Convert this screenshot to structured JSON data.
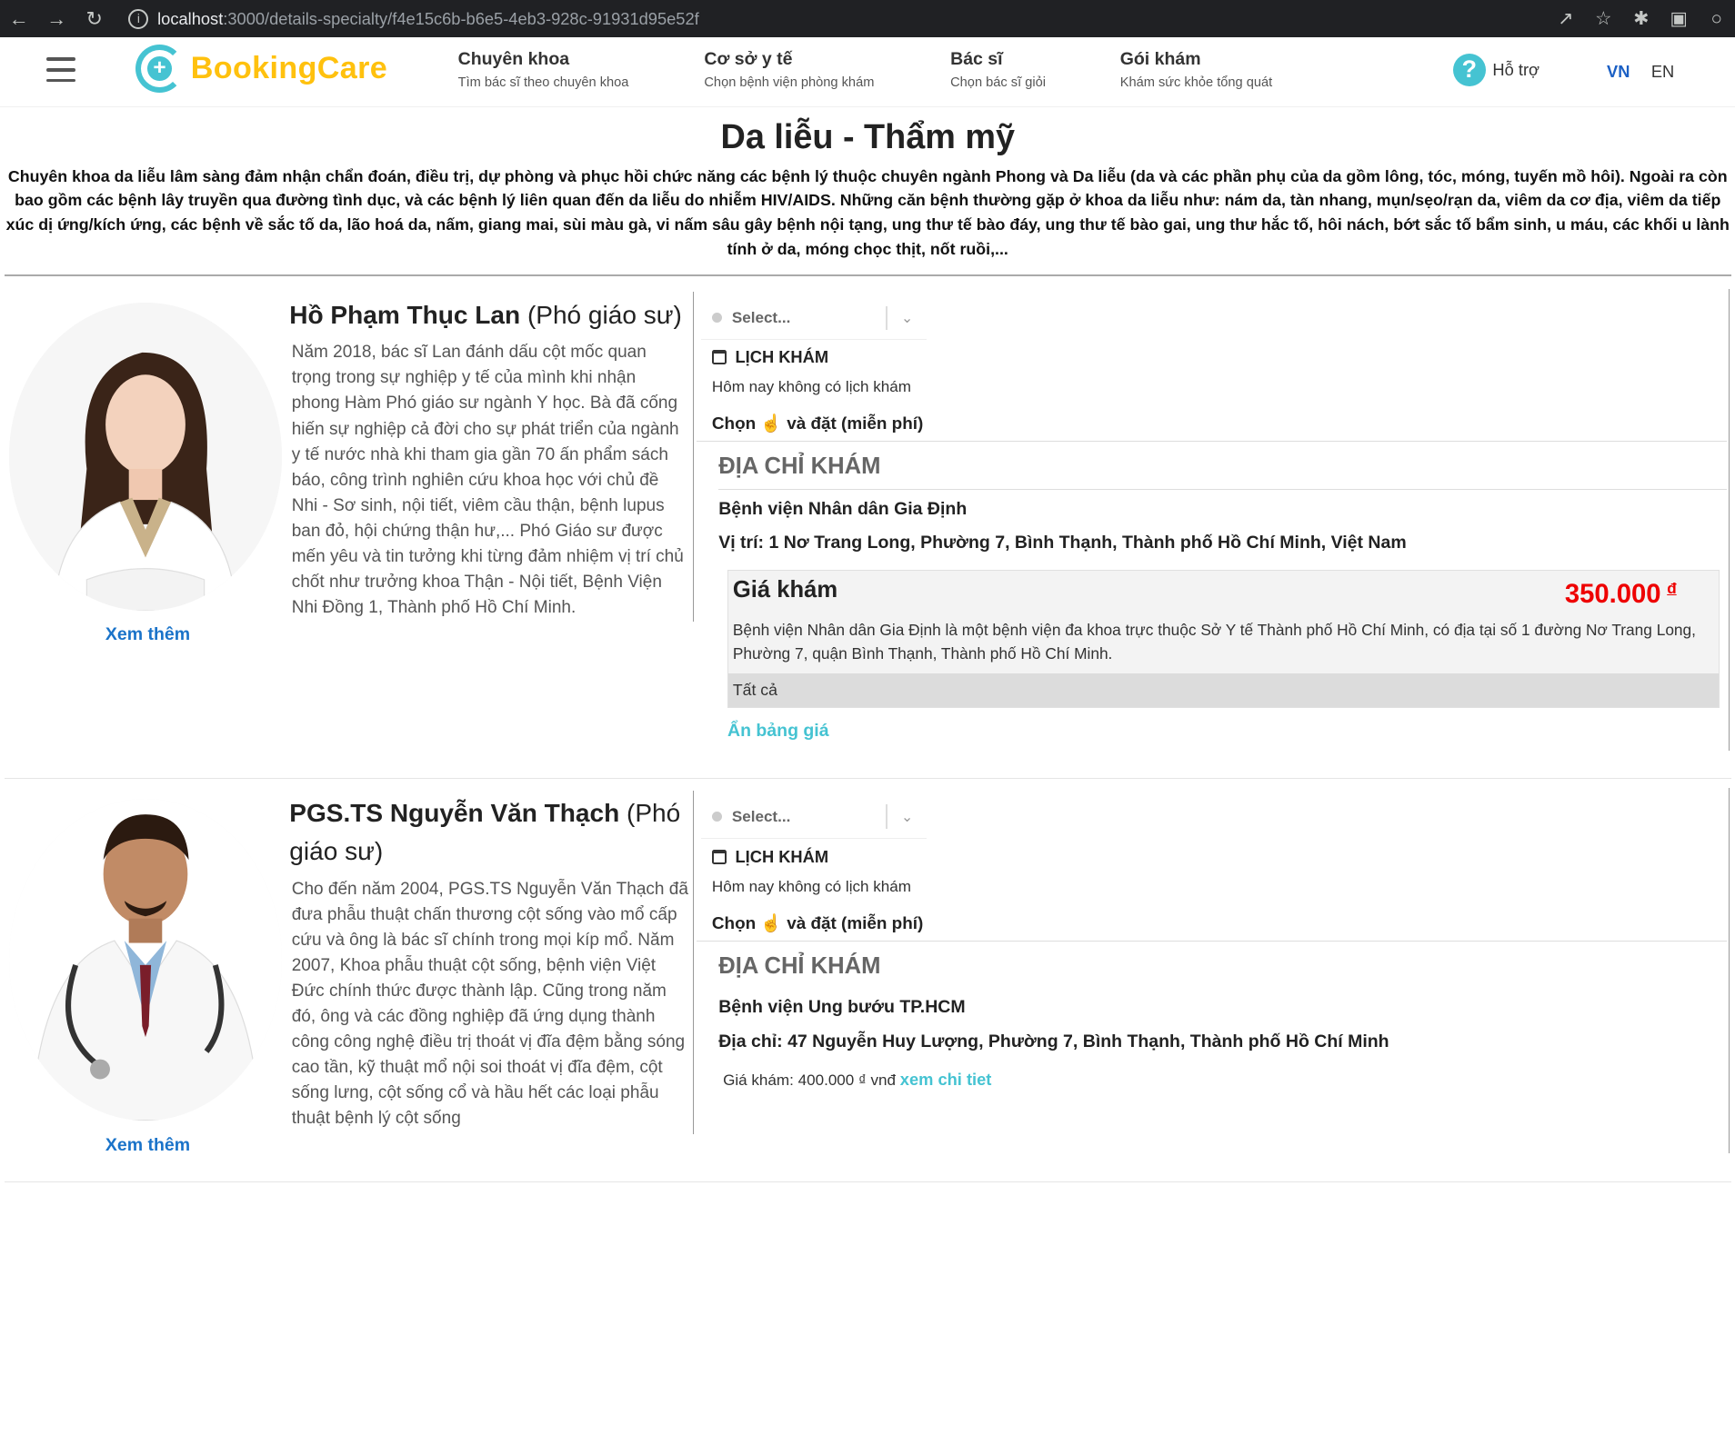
{
  "browser": {
    "url_host": "localhost",
    "url_rest": ":3000/details-specialty/f4e15c6b-b6e5-4eb3-928c-91931d95e52f"
  },
  "header": {
    "logo_text": "BookingCare",
    "menu": [
      {
        "title": "Chuyên khoa",
        "sub": "Tìm bác sĩ theo chuyên khoa"
      },
      {
        "title": "Cơ sở y tế",
        "sub": "Chọn bệnh viện phòng khám"
      },
      {
        "title": "Bác sĩ",
        "sub": "Chọn bác sĩ giỏi"
      },
      {
        "title": "Gói khám",
        "sub": "Khám sức khỏe tổng quát"
      }
    ],
    "support": "Hỗ trợ",
    "lang_vn": "VN",
    "lang_en": "EN"
  },
  "specialty": {
    "title": "Da liễu - Thẩm mỹ",
    "description": "Chuyên khoa da liễu lâm sàng đảm nhận chẩn đoán, điều trị, dự phòng và phục hồi chức năng các bệnh lý thuộc chuyên ngành Phong và Da liễu (da và các phần phụ của da gồm lông, tóc, móng, tuyến mồ hôi). Ngoài ra còn bao gồm các bệnh lây truyền qua đường tình dục, và các bệnh lý liên quan đến da liễu do nhiễm HIV/AIDS. Những căn bệnh thường gặp ở khoa da liễu như: nám da, tàn nhang, mụn/sẹo/rạn da, viêm da cơ địa, viêm da tiếp xúc dị ứng/kích ứng, các bệnh về sắc tố da, lão hoá da, nấm, giang mai, sùi màu gà, vi nấm sâu gây bệnh nội tạng, ung thư tế bào đáy, ung thư tế bào gai, ung thư hắc tố, hôi nách, bớt sắc tố bẩm sinh, u máu, các khối u lành tính ở da, móng chọc thịt, nốt ruồi,..."
  },
  "doctors": [
    {
      "name": "Hồ Phạm Thục Lan",
      "position": "(Phó giáo sư)",
      "see_more": "Xem thêm",
      "bio": "Năm 2018, bác sĩ Lan đánh dấu cột mốc quan trọng trong sự nghiệp y tế của mình khi nhận phong Hàm Phó giáo sư ngành Y học. Bà đã cống hiến sự nghiệp cả đời cho sự phát triển của ngành y tế nước nhà khi tham gia gần 70 ấn phẩm sách báo, công trình nghiên cứu khoa học với chủ đề Nhi - Sơ sinh, nội tiết, viêm cầu thận, bệnh lupus ban đỏ, hội chứng thận hư,... Phó Giáo sư được mến yêu và tin tưởng khi từng đảm nhiệm vị trí chủ chốt như trưởng khoa Thận - Nội tiết, Bệnh Viện Nhi Đồng 1, Thành phố Hồ Chí Minh.",
      "select_placeholder": "Select...",
      "schedule_title": "LỊCH KHÁM",
      "schedule_none": "Hôm nay không có lịch khám",
      "choose_prefix": "Chọn",
      "choose_suffix": "và đặt (miễn phí)",
      "address_heading": "ĐỊA CHỈ KHÁM",
      "clinic_name": "Bệnh viện Nhân dân Gia Định",
      "clinic_address": "Vị trí: 1 Nơ Trang Long, Phường 7, Bình Thạnh, Thành phố Hồ Chí Minh, Việt Nam",
      "price_heading": "Giá khám",
      "price_value": "350.000",
      "price_currency": "đ",
      "price_desc": "Bệnh viện Nhân dân Gia Định là một bệnh viện đa khoa trực thuộc Sở Y tế Thành phố Hồ Chí Minh, có địa tại số 1 đường Nơ Trang Long, Phường 7, quận Bình Thạnh, Thành phố Hồ Chí Minh.",
      "price_all": "Tất cả",
      "hide_table": "Ẩn bảng giá"
    },
    {
      "name": "PGS.TS Nguyễn Văn Thạch",
      "position": "(Phó giáo sư)",
      "see_more": "Xem thêm",
      "bio": "Cho đến năm 2004, PGS.TS Nguyễn Văn Thạch đã đưa phẫu thuật chấn thương cột sống vào mổ cấp cứu và ông là bác sĩ chính trong mọi kíp mổ. Năm 2007, Khoa phẫu thuật cột sống, bệnh viện Việt Đức chính thức được thành lập. Cũng trong năm đó, ông và các đồng nghiệp đã ứng dụng thành công công nghệ điều trị thoát vị đĩa đệm bằng sóng cao tần, kỹ thuật mổ nội soi thoát vị đĩa đệm, cột sống lưng, cột sống cổ và hầu hết các loại phẫu thuật bệnh lý cột sống",
      "select_placeholder": "Select...",
      "schedule_title": "LỊCH KHÁM",
      "schedule_none": "Hôm nay không có lịch khám",
      "choose_prefix": "Chọn",
      "choose_suffix": "và đặt (miễn phí)",
      "address_heading": "ĐỊA CHỈ KHÁM",
      "clinic_name": "Bệnh viện Ung bướu TP.HCM",
      "clinic_address": "Địa chỉ: 47 Nguyễn Huy Lượng, Phường 7, Bình Thạnh, Thành phố Hồ Chí Minh",
      "price_inline": "Giá khám: 400.000 ₫ vnđ",
      "price_link": "xem chi tiet"
    }
  ]
}
